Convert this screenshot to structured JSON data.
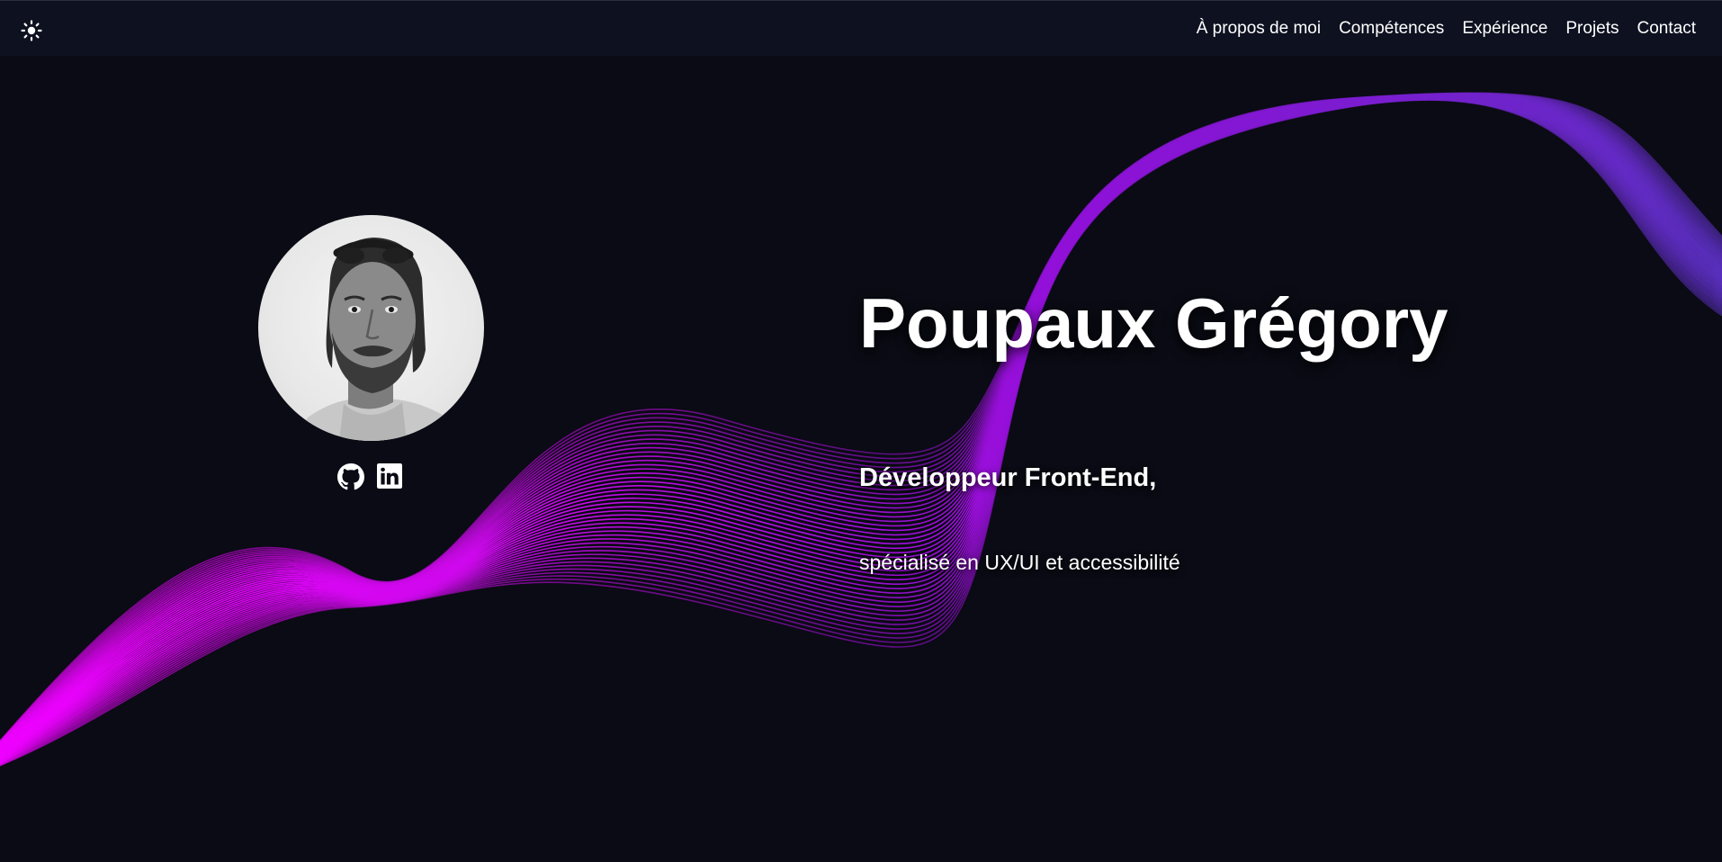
{
  "header": {
    "theme_toggle_icon": "sun-icon",
    "nav": [
      {
        "label": "À propos de moi"
      },
      {
        "label": "Compétences"
      },
      {
        "label": "Expérience"
      },
      {
        "label": "Projets"
      },
      {
        "label": "Contact"
      }
    ]
  },
  "hero": {
    "name": "Poupaux Grégory",
    "role": "Développeur Front-End,",
    "specialty": "spécialisé en UX/UI et accessibilité"
  },
  "socials": [
    {
      "icon": "github-icon"
    },
    {
      "icon": "linkedin-icon"
    }
  ],
  "colors": {
    "background": "#0a0b14",
    "navbar": "#0e1120",
    "text": "#ffffff",
    "wave_magenta": "#ee00ff",
    "wave_violet": "#8a18d6",
    "wave_indigo": "#5a2fc0"
  }
}
